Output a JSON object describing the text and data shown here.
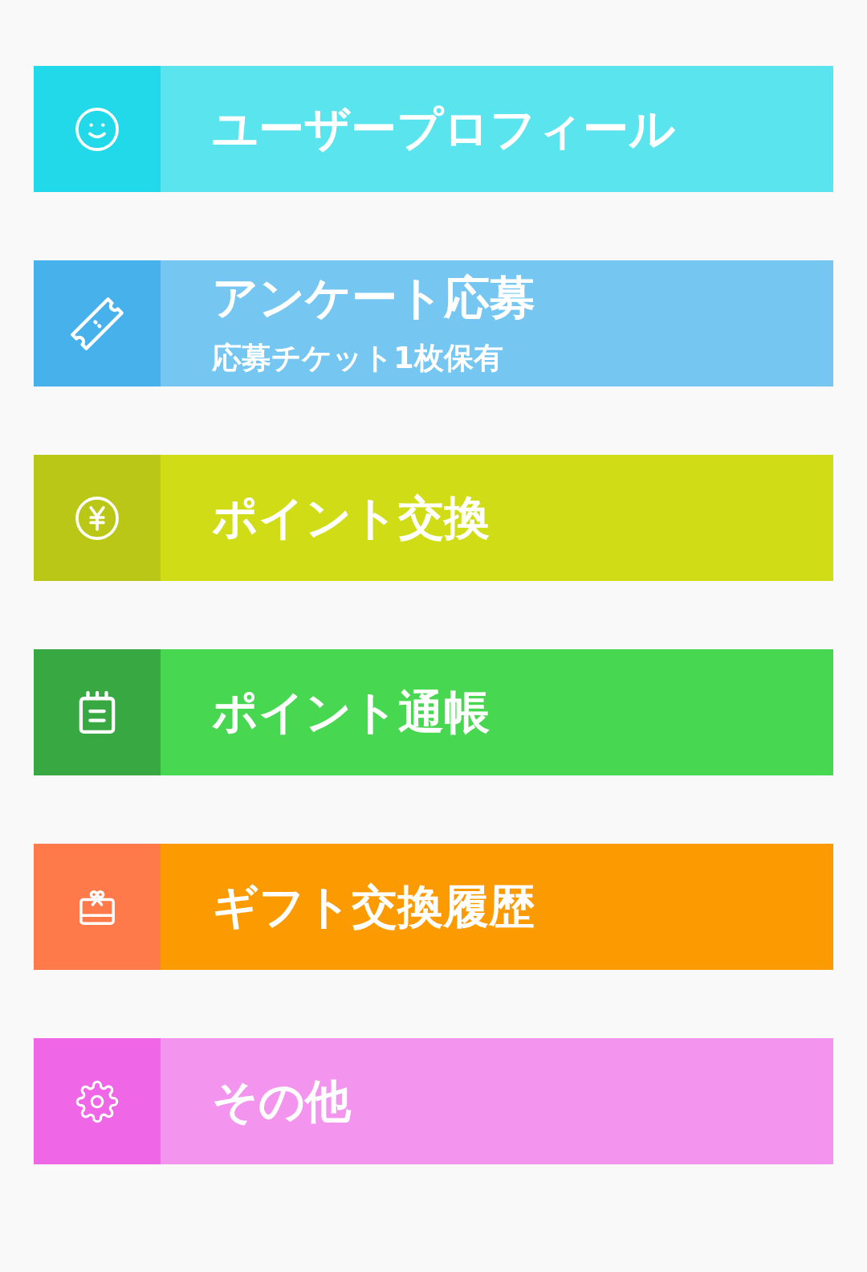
{
  "menu": {
    "items": [
      {
        "title": "ユーザープロフィール",
        "color": "#5ae4ee",
        "icon_panel": {
          "color": "#22d9ea"
        }
      },
      {
        "title": "アンケート応募",
        "subtitle": "応募チケット1枚保有",
        "color": "#76c6f2",
        "icon_panel": {
          "color": "#47b1ec"
        }
      },
      {
        "title": "ポイント交換",
        "color": "#d0dd16",
        "icon_panel": {
          "color": "#bbc716"
        }
      },
      {
        "title": "ポイント通帳",
        "color": "#48d751",
        "icon_panel": {
          "color": "#38a843"
        }
      },
      {
        "title": "ギフト交換履歴",
        "color": "#fc9a02",
        "icon_panel": {
          "color": "#ff7a4a"
        }
      },
      {
        "title": "その他",
        "color": "#f395ee",
        "icon_panel": {
          "color": "#ef66e6"
        }
      }
    ]
  }
}
